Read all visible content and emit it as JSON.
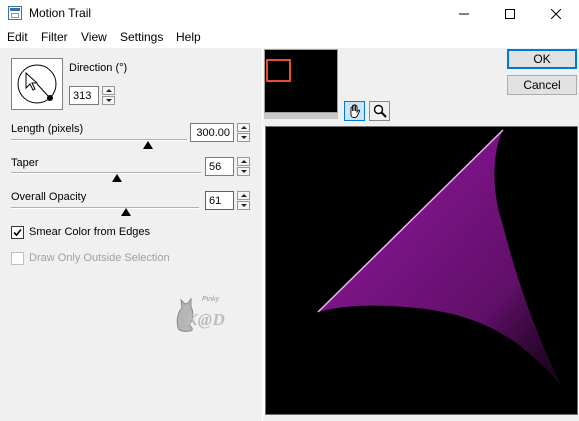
{
  "window": {
    "title": "Motion Trail",
    "minimize_icon": "minimize-icon",
    "maximize_icon": "maximize-icon",
    "close_icon": "close-icon"
  },
  "menu": {
    "items": [
      "Edit",
      "Filter",
      "View",
      "Settings",
      "Help"
    ]
  },
  "direction": {
    "label": "Direction (°)",
    "value": "313"
  },
  "length": {
    "label": "Length (pixels)",
    "value": "300.00",
    "slider_level": 0.78
  },
  "taper": {
    "label": "Taper",
    "value": "56",
    "slider_level": 0.56
  },
  "opacity": {
    "label": "Overall Opacity",
    "value": "61",
    "slider_level": 0.61
  },
  "options": {
    "smear_label": "Smear Color from Edges",
    "smear_checked": true,
    "draw_only_label": "Draw Only Outside Selection",
    "draw_only_checked": false,
    "draw_only_enabled": false
  },
  "watermark": {
    "small": "Pinky",
    "main": "K@D"
  },
  "buttons": {
    "ok": "OK",
    "cancel": "Cancel"
  },
  "tools": {
    "pan_icon": "hand-icon",
    "zoom_icon": "magnifier-icon"
  },
  "colors": {
    "trail": "#a21ab0",
    "preview_bg": "#000000",
    "nav_rect": "#ea4b35"
  }
}
